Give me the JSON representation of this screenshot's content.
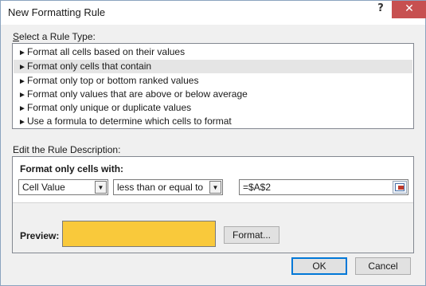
{
  "window": {
    "title": "New Formatting Rule",
    "help_glyph": "?",
    "close_glyph": "✕"
  },
  "rule_type": {
    "label": "Select a Rule Type:",
    "items": [
      "Format all cells based on their values",
      "Format only cells that contain",
      "Format only top or bottom ranked values",
      "Format only values that are above or below average",
      "Format only unique or duplicate values",
      "Use a formula to determine which cells to format"
    ],
    "selected_index": 1,
    "arrow_glyph": "►"
  },
  "edit": {
    "label": "Edit the Rule Description:",
    "format_only_label": "Format only cells with:",
    "condition_type": "Cell Value",
    "operator": "less than or equal to",
    "value": "=$A$2",
    "preview_label": "Preview:",
    "preview_color": "#f9c93b",
    "format_button": "Format..."
  },
  "buttons": {
    "ok": "OK",
    "cancel": "Cancel"
  },
  "icons": {
    "dropdown": "chevron-down-icon",
    "range": "range-select-icon"
  }
}
